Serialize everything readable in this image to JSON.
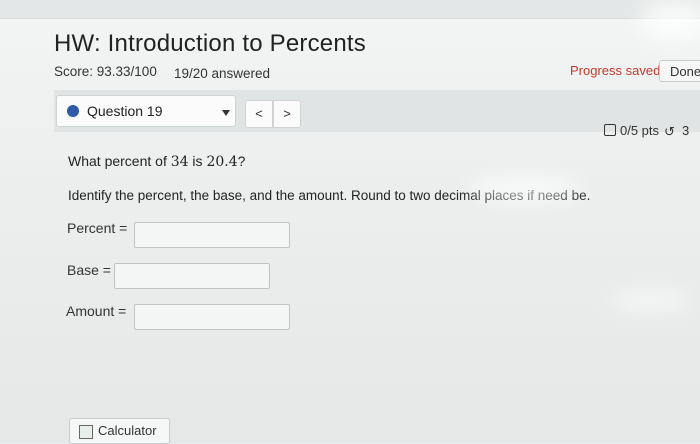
{
  "header": {
    "title": "HW: Introduction to Percents",
    "score": "Score: 93.33/100",
    "answered": "19/20 answered",
    "progress_saved": "Progress saved",
    "done_label": "Done"
  },
  "question_nav": {
    "selected": "Question 19",
    "prev_label": "<",
    "next_label": ">"
  },
  "points": {
    "pts": "0/5 pts",
    "retries": "3"
  },
  "question": {
    "prefix": "What percent of ",
    "base": "34",
    "middle": " is ",
    "amount": "20.4",
    "suffix": "?",
    "instruction": "Identify the percent, the base, and the amount. Round to two decimal places if need be."
  },
  "fields": {
    "percent_label": "Percent =",
    "base_label": "Base =",
    "amount_label": "Amount ="
  },
  "calculator": {
    "label": "Calculator"
  },
  "colors": {
    "accent": "#2e5aa8",
    "saved": "#c0392b"
  }
}
